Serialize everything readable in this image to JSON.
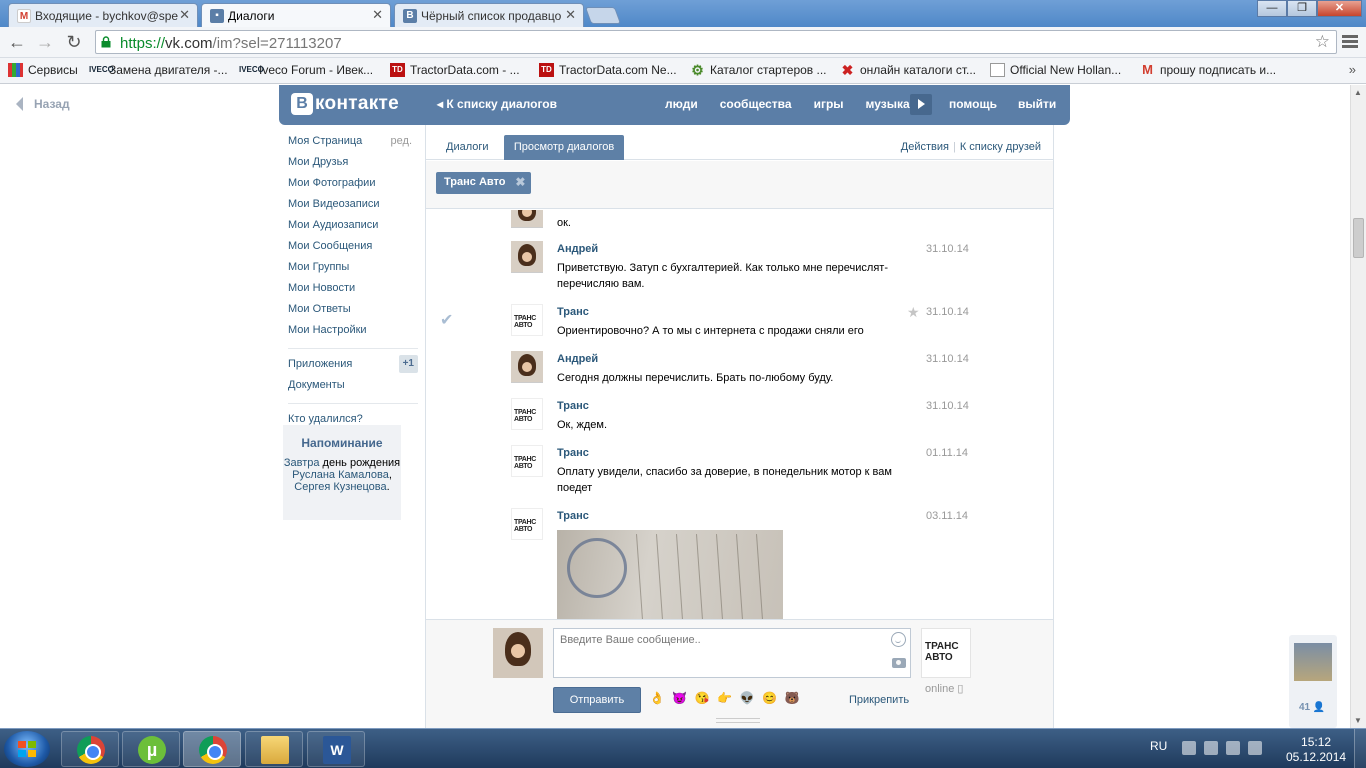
{
  "browser": {
    "tabs": [
      {
        "title": "Входящие - bychkov@spe",
        "favicon": "gmail-icon",
        "active": false
      },
      {
        "title": "Диалоги",
        "favicon": "vk-chat-icon",
        "active": true
      },
      {
        "title": "Чёрный список продавцо",
        "favicon": "vk-icon",
        "active": false
      }
    ],
    "url_scheme": "https://",
    "url_host": "vk.com",
    "url_path": "/im?sel=271113207",
    "bookmarks": [
      {
        "label": "Сервисы",
        "icon": "apps-icon"
      },
      {
        "label": "Замена двигателя -...",
        "icon": "iveco-icon"
      },
      {
        "label": "Iveco Forum - Ивек...",
        "icon": "iveco-icon"
      },
      {
        "label": "TractorData.com - ...",
        "icon": "td-icon"
      },
      {
        "label": "TractorData.com Ne...",
        "icon": "td-icon"
      },
      {
        "label": "Каталог стартеров ...",
        "icon": "gear-icon"
      },
      {
        "label": "онлайн каталоги ст...",
        "icon": "cross-icon"
      },
      {
        "label": "Official New Hollan...",
        "icon": "page-icon"
      },
      {
        "label": "прошу подписать и...",
        "icon": "gmail-icon"
      }
    ]
  },
  "vk": {
    "back": "Назад",
    "logo_letter": "В",
    "logo_text": "контакте",
    "to_dialogs": "К списку диалогов",
    "nav": [
      "люди",
      "сообщества",
      "игры",
      "музыка"
    ],
    "nav2": [
      "помощь",
      "выйти"
    ],
    "menu": [
      {
        "label": "Моя Страница",
        "extra": "ред."
      },
      {
        "label": "Мои Друзья"
      },
      {
        "label": "Мои Фотографии"
      },
      {
        "label": "Мои Видеозаписи"
      },
      {
        "label": "Мои Аудиозаписи"
      },
      {
        "label": "Мои Сообщения"
      },
      {
        "label": "Мои Группы"
      },
      {
        "label": "Мои Новости"
      },
      {
        "label": "Мои Ответы"
      },
      {
        "label": "Мои Настройки"
      }
    ],
    "menu2": [
      {
        "label": "Приложения",
        "badge": "+1"
      },
      {
        "label": "Документы"
      }
    ],
    "menu3": "Кто удалился?",
    "reminder": {
      "title": "Напоминание",
      "w1": "Завтра",
      "w2": " день рождения ",
      "p1": "Руслана Камалова",
      "sep": ", ",
      "p2": "Сергея Кузнецова",
      "end": "."
    },
    "tabs": {
      "dialogs": "Диалоги",
      "view": "Просмотр диалогов",
      "actions": "Действия",
      "friends": "К списку друзей"
    },
    "peer": "Транс Авто",
    "messages": [
      {
        "author": "",
        "date": "",
        "text": "ок.",
        "avatar": "andrey"
      },
      {
        "author": "Андрей",
        "date": "31.10.14",
        "text": "Приветствую. Затуп с бухгалтерией. Как только мне перечислят-перечисляю вам.",
        "avatar": "andrey"
      },
      {
        "author": "Транс",
        "date": "31.10.14",
        "text": "Ориентировочно? А то мы с интернета с продажи сняли его",
        "avatar": "trans"
      },
      {
        "author": "Андрей",
        "date": "31.10.14",
        "text": "Сегодня должны перечислить. Брать по-любому буду.",
        "avatar": "andrey"
      },
      {
        "author": "Транс",
        "date": "31.10.14",
        "text": "Ок, ждем.",
        "avatar": "trans"
      },
      {
        "author": "Транс",
        "date": "01.11.14",
        "text": "Оплату увидели, спасибо за доверие, в понедельник мотор к вам поедет",
        "avatar": "trans"
      },
      {
        "author": "Транс",
        "date": "03.11.14",
        "text": "",
        "avatar": "trans"
      }
    ],
    "avatar_logo": "ТРАНС АВТО",
    "composer": {
      "placeholder": "Введите Ваше сообщение..",
      "send": "Отправить",
      "attach": "Прикрепить",
      "online": "online"
    },
    "emojis": [
      "👌",
      "😈",
      "😘",
      "👉",
      "👽",
      "😊",
      "🐻"
    ],
    "widget_count": "41"
  },
  "taskbar": {
    "lang": "RU",
    "time": "15:12",
    "date": "05.12.2014"
  },
  "colors": {
    "vk_blue": "#5b7ea7",
    "link": "#2b587a",
    "chrome_blue": "#4f88c8"
  }
}
